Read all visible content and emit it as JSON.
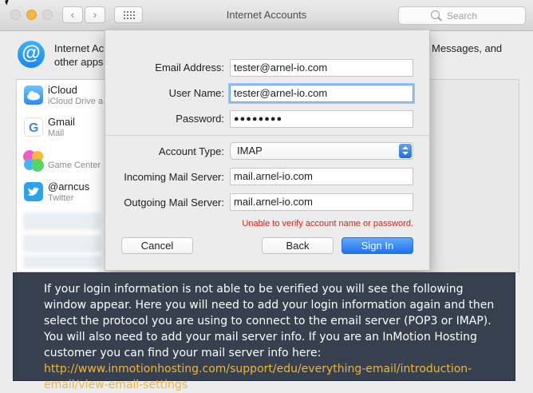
{
  "window": {
    "title": "Internet Accounts"
  },
  "search": {
    "placeholder": "Search",
    "icon": "search-icon"
  },
  "description": {
    "line1_left": "Internet Ac",
    "line1_right": "Messages, and",
    "line2": "other apps"
  },
  "accounts": [
    {
      "name": "iCloud",
      "sub": "iCloud Drive a",
      "icon": "icloud-icon"
    },
    {
      "name": "Gmail",
      "sub": "Mail",
      "icon": "google-icon"
    },
    {
      "name": "",
      "sub": "Game Center",
      "icon": "game-center-icon"
    },
    {
      "name": "@arncus",
      "sub": "Twitter",
      "icon": "twitter-icon"
    }
  ],
  "form": {
    "email_label": "Email Address:",
    "email_value": "tester@arnel-io.com",
    "username_label": "User Name:",
    "username_value": "tester@arnel-io.com",
    "password_label": "Password:",
    "password_value": "●●●●●●●●",
    "account_type_label": "Account Type:",
    "account_type_value": "IMAP",
    "incoming_label": "Incoming Mail Server:",
    "incoming_value": "mail.arnel-io.com",
    "outgoing_label": "Outgoing Mail Server:",
    "outgoing_value": "mail.arnel-io.com",
    "error": "Unable to verify account name or password.",
    "cancel": "Cancel",
    "back": "Back",
    "sign_in": "Sign In"
  },
  "banner": {
    "text": "If your login information is not able to be verified you will see the following window appear.  Here you will need to add your login information again and then select the protocol you are using to connect to the email server (POP3 or IMAP).  You will also need to add your mail server info.  If you are an InMotion Hosting customer you can find your mail server info here: ",
    "link": "http://www.inmotionhosting.com/support/edu/everything-email/introduction-email/view-email-settings"
  },
  "colors": {
    "accent": "#1d72ee",
    "error": "#d0241a",
    "link": "#f0b53c",
    "banner_bg": "#36404f"
  }
}
